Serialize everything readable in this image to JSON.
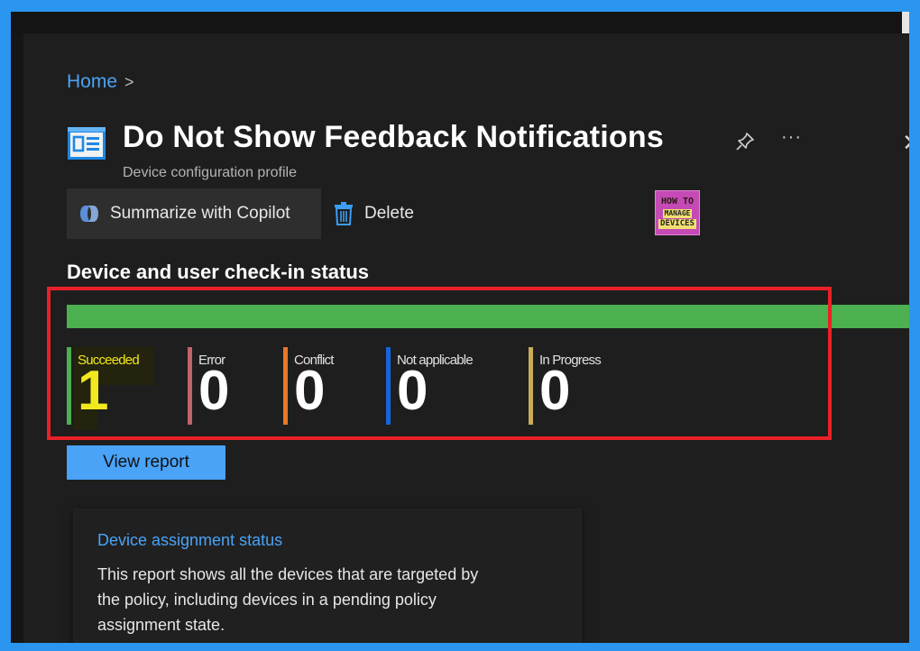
{
  "breadcrumb": {
    "home": "Home",
    "separator": ">"
  },
  "header": {
    "title": "Do Not Show Feedback Notifications",
    "subtitle": "Device configuration profile",
    "more": "···",
    "close": "✕"
  },
  "toolbar": {
    "copilot_label": "Summarize with Copilot",
    "delete_label": "Delete"
  },
  "logo": {
    "line1": "HOW TO",
    "line2": "MANAGE",
    "line3": "DEVICES"
  },
  "status": {
    "heading": "Device and user check-in status",
    "success_fraction": 1.0,
    "stats": [
      {
        "label": "Succeeded",
        "value": "1",
        "color": "#4caf50"
      },
      {
        "label": "Error",
        "value": "0",
        "color": "#c0646a"
      },
      {
        "label": "Conflict",
        "value": "0",
        "color": "#e8782a"
      },
      {
        "label": "Not applicable",
        "value": "0",
        "color": "#1565e0"
      },
      {
        "label": "In Progress",
        "value": "0",
        "color": "#c8ad5a"
      }
    ]
  },
  "view_report_label": "View report",
  "card": {
    "title": "Device assignment status",
    "description": "This report shows all the devices that are targeted by the policy, including devices in a pending policy assignment state."
  },
  "colors": {
    "accent": "#4aa3f7",
    "success": "#4caf50",
    "highlight": "#ea2027",
    "succeeded_text": "#f2e81e"
  }
}
